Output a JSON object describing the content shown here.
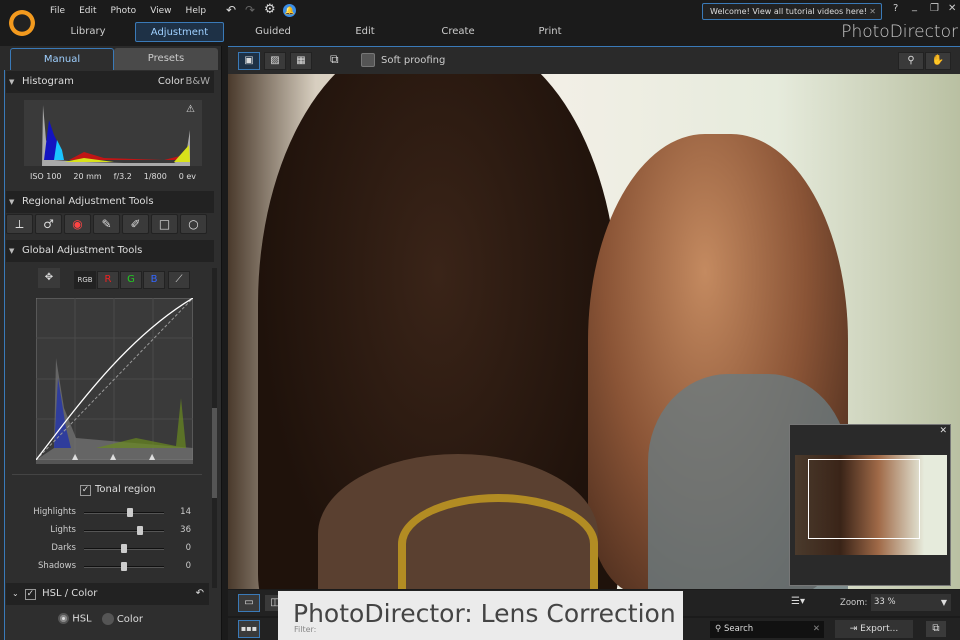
{
  "menu": [
    "File",
    "Edit",
    "Photo",
    "View",
    "Help"
  ],
  "tooltip": "Welcome! View all tutorial videos here!",
  "window_controls": {
    "help": "?",
    "minimize": "_",
    "restore": "❐",
    "close": "✕"
  },
  "brand": "PhotoDirector",
  "modes": [
    "Library",
    "Adjustment",
    "Guided",
    "Edit",
    "Create",
    "Print"
  ],
  "active_mode": "Adjustment",
  "panel_tabs": [
    "Manual",
    "Presets"
  ],
  "histogram": {
    "title": "Histogram",
    "color": "Color",
    "bw": "B&W",
    "info": [
      "ISO 100",
      "20 mm",
      "f/3.2",
      "1/800",
      "0 ev"
    ]
  },
  "regional": {
    "title": "Regional Adjustment Tools"
  },
  "global": {
    "title": "Global Adjustment Tools",
    "channels": [
      "RGB",
      "R",
      "G",
      "B"
    ]
  },
  "tonal": {
    "label": "Tonal region",
    "checked": true,
    "sliders": [
      {
        "label": "Highlights",
        "value": 14
      },
      {
        "label": "Lights",
        "value": 36
      },
      {
        "label": "Darks",
        "value": 0
      },
      {
        "label": "Shadows",
        "value": 0
      }
    ]
  },
  "hsl": {
    "title": "HSL / Color",
    "options": [
      "HSL",
      "Color"
    ],
    "selected": "HSL"
  },
  "viewer": {
    "soft_proofing": "Soft proofing",
    "zoom_label": "Zoom:",
    "zoom_value": "33 %"
  },
  "bottom": {
    "filter": "Filter:",
    "search_placeholder": "Search",
    "export": "Export..."
  },
  "caption": "PhotoDirector: Lens Correction"
}
